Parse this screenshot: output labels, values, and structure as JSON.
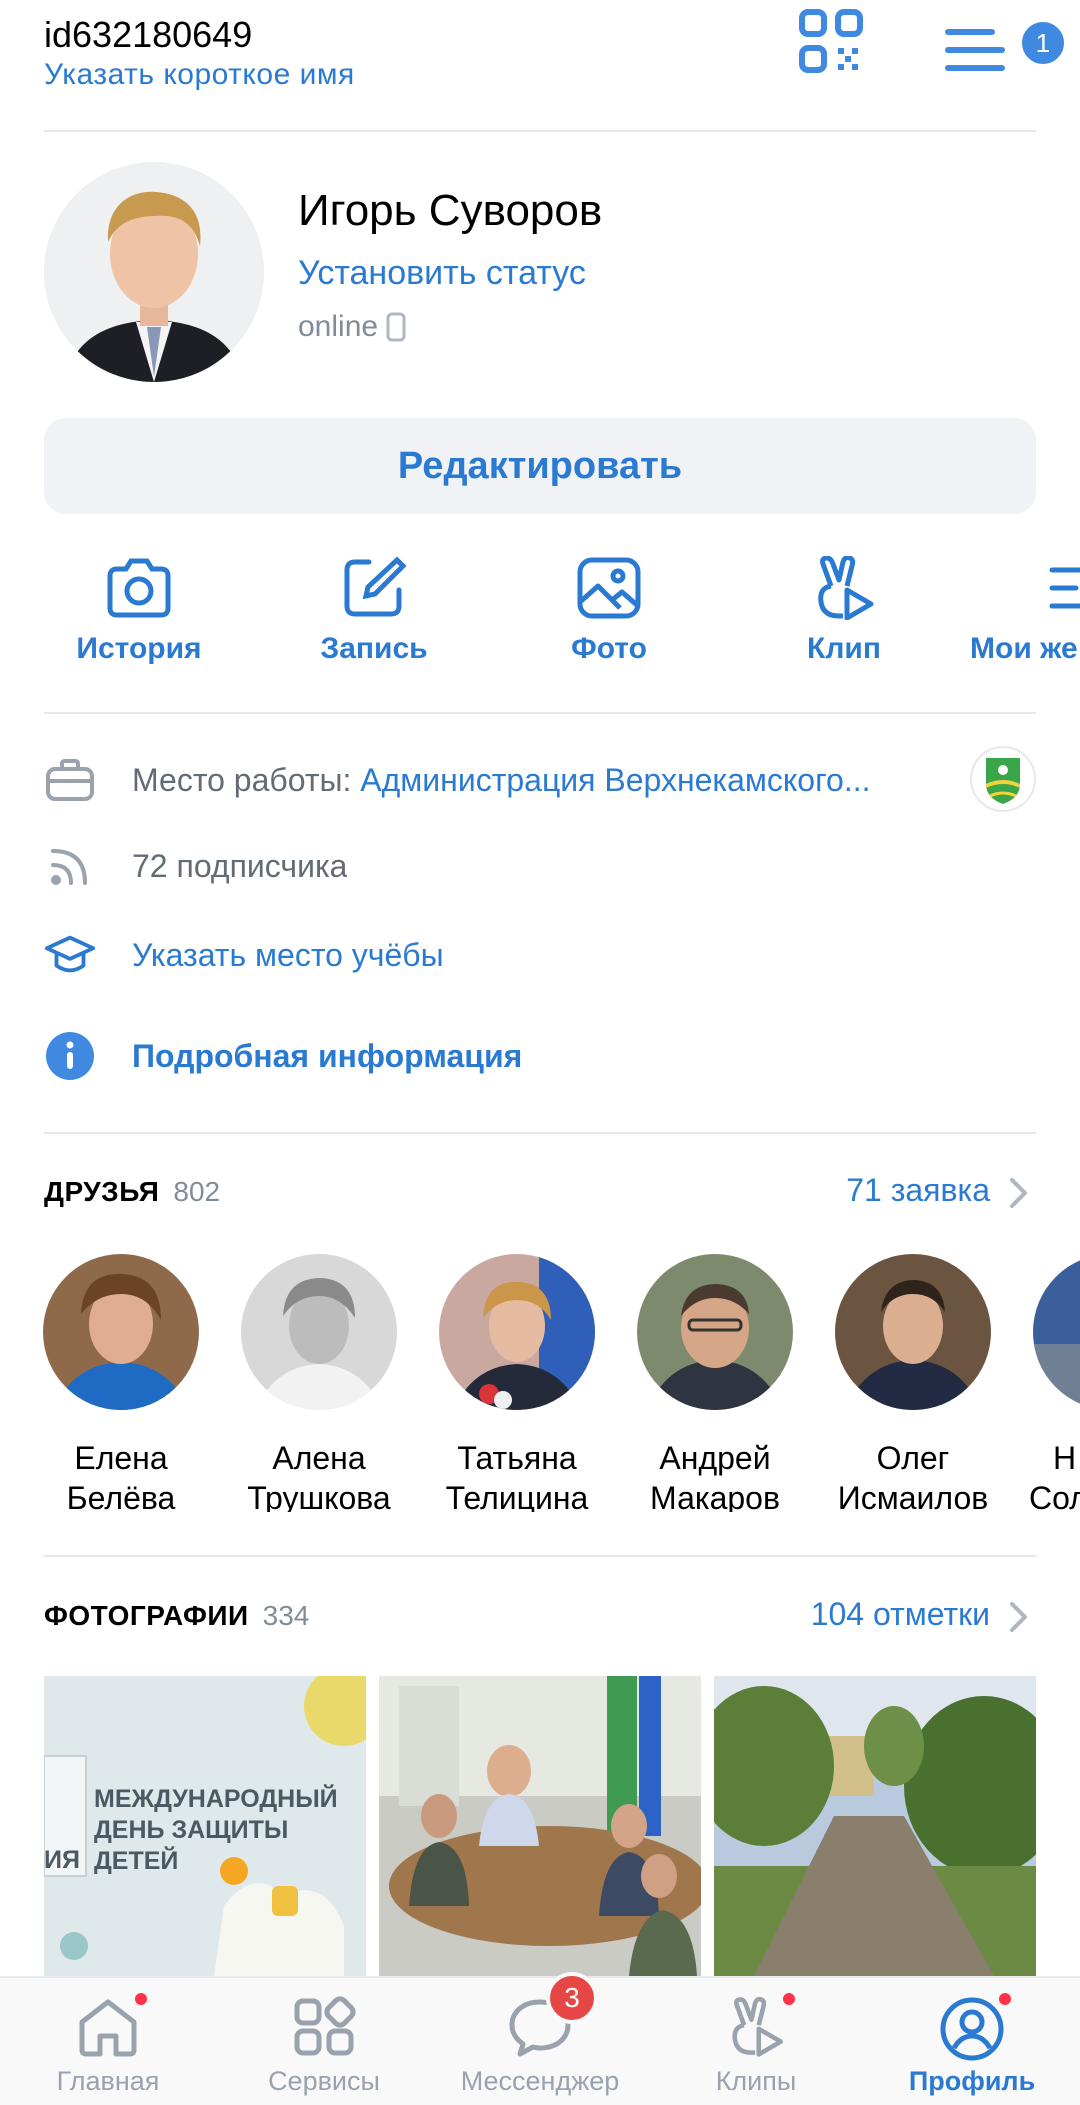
{
  "header": {
    "user_id": "id632180649",
    "short_name_link": "Указать короткое имя",
    "menu_badge": "1"
  },
  "profile": {
    "name": "Игорь Суворов",
    "status_link": "Установить статус",
    "online": "online",
    "edit_button": "Редактировать"
  },
  "actions": [
    {
      "label": "История",
      "icon": "camera-icon"
    },
    {
      "label": "Запись",
      "icon": "edit-note-icon"
    },
    {
      "label": "Фото",
      "icon": "photo-icon"
    },
    {
      "label": "Клип",
      "icon": "clip-icon"
    },
    {
      "label": "Мои же",
      "icon": "list-icon"
    }
  ],
  "info": {
    "work_label": "Место работы: ",
    "work_value": "Администрация Верхнекамского...",
    "followers": "72 подписчика",
    "education_link": "Указать место учёбы",
    "details_link": "Подробная информация"
  },
  "friends": {
    "title": "ДРУЗЬЯ",
    "count": "802",
    "requests": "71 заявка",
    "items": [
      {
        "first": "Елена",
        "last": "Белёва"
      },
      {
        "first": "Алена",
        "last": "Трушкова"
      },
      {
        "first": "Татьяна",
        "last": "Телицина"
      },
      {
        "first": "Андрей",
        "last": "Макаров"
      },
      {
        "first": "Олег",
        "last": "Исмаилов"
      },
      {
        "first": "Н",
        "last": "Сол"
      }
    ]
  },
  "photos": {
    "title": "ФОТОГРАФИИ",
    "count": "334",
    "tags": "104 отметки",
    "first_photo_text": [
      "МЕЖДУНАРОДНЫЙ",
      "ДЕНЬ ЗАЩИТЫ",
      "ДЕТЕЙ"
    ],
    "first_photo_edge": "ИЯ"
  },
  "tabbar": {
    "tabs": [
      {
        "label": "Главная",
        "icon": "home-icon"
      },
      {
        "label": "Сервисы",
        "icon": "services-icon"
      },
      {
        "label": "Мессенджер",
        "icon": "messenger-icon",
        "badge": "3"
      },
      {
        "label": "Клипы",
        "icon": "clips-icon"
      },
      {
        "label": "Профиль",
        "icon": "profile-icon"
      }
    ]
  },
  "colors": {
    "accent": "#2a7ad1",
    "secondary_text": "#818c99",
    "badge_red": "#e64646"
  }
}
